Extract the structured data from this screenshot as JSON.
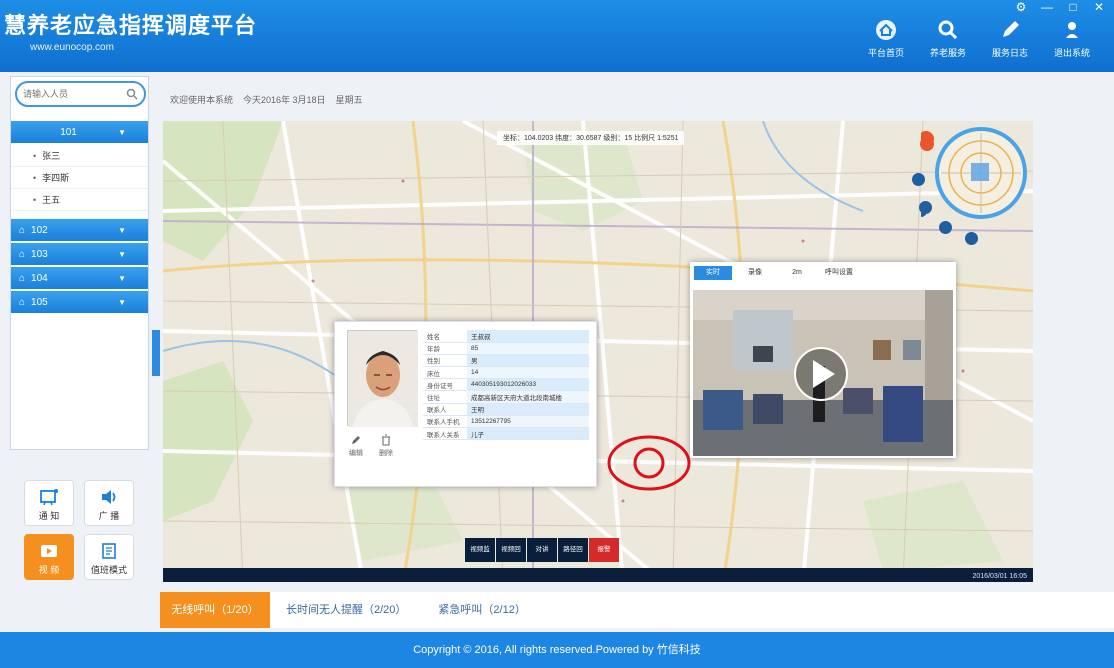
{
  "app": {
    "title": "慧养老应急指挥调度平台",
    "url": "www.eunocop.com"
  },
  "window_controls": {
    "settings": "⚙",
    "minimize": "—",
    "maximize": "□",
    "close": "✕"
  },
  "toolbar": {
    "items": [
      {
        "label": "平台首页",
        "icon": "home-icon"
      },
      {
        "label": "养老服务",
        "icon": "search-icon"
      },
      {
        "label": "服务日志",
        "icon": "pen-icon"
      },
      {
        "label": "退出系统",
        "icon": "exit-icon"
      }
    ]
  },
  "sidebar": {
    "search_placeholder": "请输入人员",
    "groups": [
      {
        "label": "101"
      },
      {
        "label": "102"
      },
      {
        "label": "103"
      },
      {
        "label": "104"
      },
      {
        "label": "105"
      }
    ],
    "sub_items": [
      {
        "label": "张三"
      },
      {
        "label": "李四斯"
      },
      {
        "label": "王五"
      }
    ]
  },
  "actions": {
    "notify": "通 知",
    "broadcast": "广 播",
    "video": "视 频",
    "monitor": "值班模式"
  },
  "breadcrumb": [
    "欢迎使用本系统",
    "今天2016年 3月18日",
    "星期五"
  ],
  "map": {
    "coords": "坐标：104.0203  纬度：30.6587   级别：15   比例尺 1:5251",
    "bottom_status": "2016/03/01 16:05"
  },
  "info_card": {
    "rows": [
      {
        "k": "姓名",
        "v": "王叔叔"
      },
      {
        "k": "年龄",
        "v": "85"
      },
      {
        "k": "性别",
        "v": "男"
      },
      {
        "k": "床位",
        "v": "14"
      },
      {
        "k": "身份证号",
        "v": "440305193012026033"
      },
      {
        "k": "住址",
        "v": "成都高新区天府大道北段南城楼"
      },
      {
        "k": "联系人",
        "v": "王明"
      },
      {
        "k": "联系人手机",
        "v": "13512267795"
      },
      {
        "k": "联系人关系",
        "v": "儿子"
      }
    ],
    "edit": "编辑",
    "delete": "删除"
  },
  "video_card": {
    "tabs": [
      "实时",
      "录像",
      "2m",
      "呼叫设置"
    ]
  },
  "map_toolbar": {
    "items": [
      "视频监",
      "视频回",
      "对讲",
      "路径回",
      "报警"
    ]
  },
  "bottom_tabs": {
    "items": [
      {
        "label": "无线呼叫（1/20）"
      },
      {
        "label": "长时间无人提醒（2/20）"
      },
      {
        "label": "紧急呼叫（2/12）"
      }
    ]
  },
  "footer": {
    "text": "Copyright © 2016, All rights reserved.Powered by 竹信科技"
  },
  "colors": {
    "primary": "#1d86e2",
    "accent": "#f5901e",
    "alarm": "#d42a2a"
  }
}
